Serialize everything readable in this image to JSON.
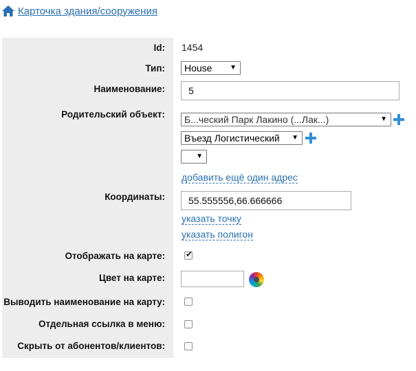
{
  "breadcrumb": {
    "icon": "home-icon",
    "label": "Карточка здания/сооружения",
    "color": "#2a6fb1"
  },
  "form": {
    "id": {
      "label": "Id:",
      "value": "1454"
    },
    "type": {
      "label": "Тип:",
      "selected": "House"
    },
    "name": {
      "label": "Наименование:",
      "value": "5"
    },
    "parent": {
      "label": "Родительский объект:",
      "selected": "Б...ческий Парк Лакино (...Лак...)",
      "street_selected": "Въезд Логистический",
      "third_selected": ""
    },
    "add_address_link": "добавить ещё один адрес",
    "coords": {
      "label": "Координаты:",
      "value": "55.555556,66.666666"
    },
    "point_link": "указать точку",
    "polygon_link": "указать полигон",
    "show_on_map": {
      "label": "Отображать на карте:",
      "checked": true
    },
    "map_color": {
      "label": "Цвет на карте:",
      "value": ""
    },
    "show_name_on_map": {
      "label": "Выводить наименование на карту:",
      "checked": false
    },
    "separate_link": {
      "label": "Отдельная ссылка в меню:",
      "checked": false
    },
    "hide_from_subscribers": {
      "label": "Скрыть от абонентов/клиентов:",
      "checked": false
    }
  },
  "colors": {
    "accent": "#2a6fb1",
    "plus": "#2f8fd8",
    "label_bg": "#ededed"
  }
}
